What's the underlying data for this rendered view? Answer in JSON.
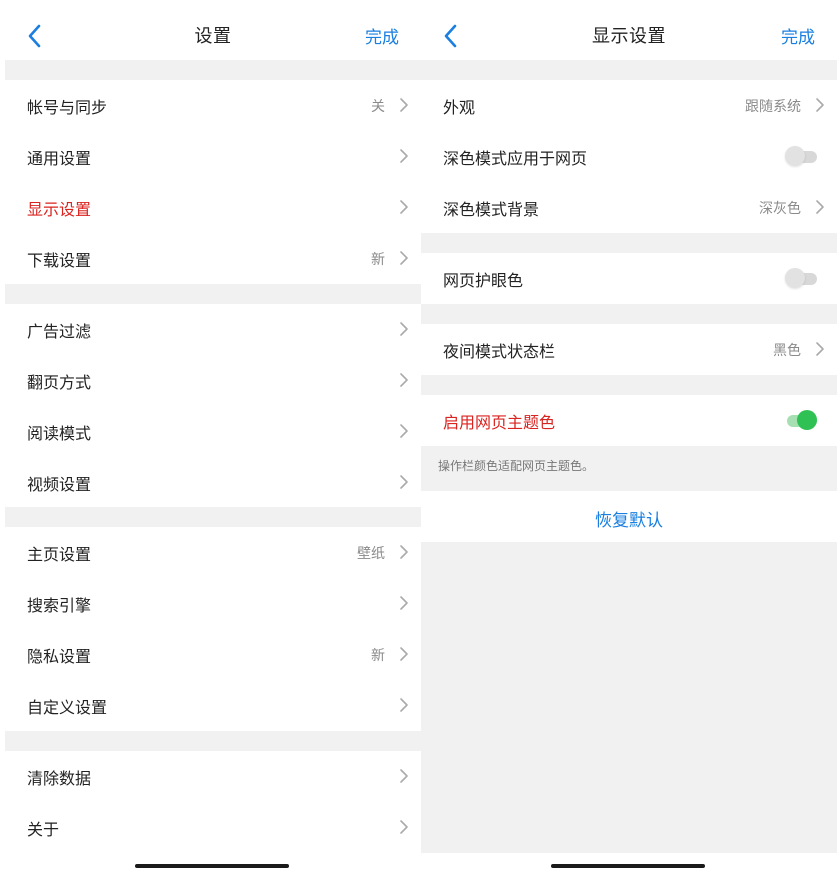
{
  "left": {
    "nav": {
      "title": "设置",
      "done": "完成"
    },
    "groups": [
      {
        "items": [
          {
            "label": "帐号与同步",
            "value": "关"
          },
          {
            "label": "通用设置",
            "value": ""
          },
          {
            "label": "显示设置",
            "value": "",
            "highlight": true
          },
          {
            "label": "下载设置",
            "value": "新"
          }
        ]
      },
      {
        "items": [
          {
            "label": "广告过滤",
            "value": ""
          },
          {
            "label": "翻页方式",
            "value": ""
          },
          {
            "label": "阅读模式",
            "value": ""
          },
          {
            "label": "视频设置",
            "value": ""
          }
        ]
      },
      {
        "items": [
          {
            "label": "主页设置",
            "value": "壁纸"
          },
          {
            "label": "搜索引擎",
            "value": ""
          },
          {
            "label": "隐私设置",
            "value": "新"
          },
          {
            "label": "自定义设置",
            "value": ""
          }
        ]
      },
      {
        "items": [
          {
            "label": "清除数据",
            "value": ""
          },
          {
            "label": "关于",
            "value": ""
          }
        ]
      }
    ]
  },
  "right": {
    "nav": {
      "title": "显示设置",
      "done": "完成"
    },
    "appearance": {
      "label": "外观",
      "value": "跟随系统"
    },
    "dark_web": {
      "label": "深色模式应用于网页",
      "enabled": false
    },
    "dark_bg": {
      "label": "深色模式背景",
      "value": "深灰色"
    },
    "eye_care": {
      "label": "网页护眼色",
      "enabled": false
    },
    "night_statusbar": {
      "label": "夜间模式状态栏",
      "value": "黑色"
    },
    "theme_color": {
      "label": "启用网页主题色",
      "enabled": true
    },
    "hint": "操作栏颜色适配网页主题色。",
    "restore": "恢复默认"
  },
  "colors": {
    "accent": "#1a7fe0",
    "highlight": "#d9231f",
    "toggle_on": "#2fc154",
    "background": "#f1f1f1"
  },
  "icons": {
    "back": "chevron-left-icon",
    "disclosure": "chevron-right-icon"
  }
}
